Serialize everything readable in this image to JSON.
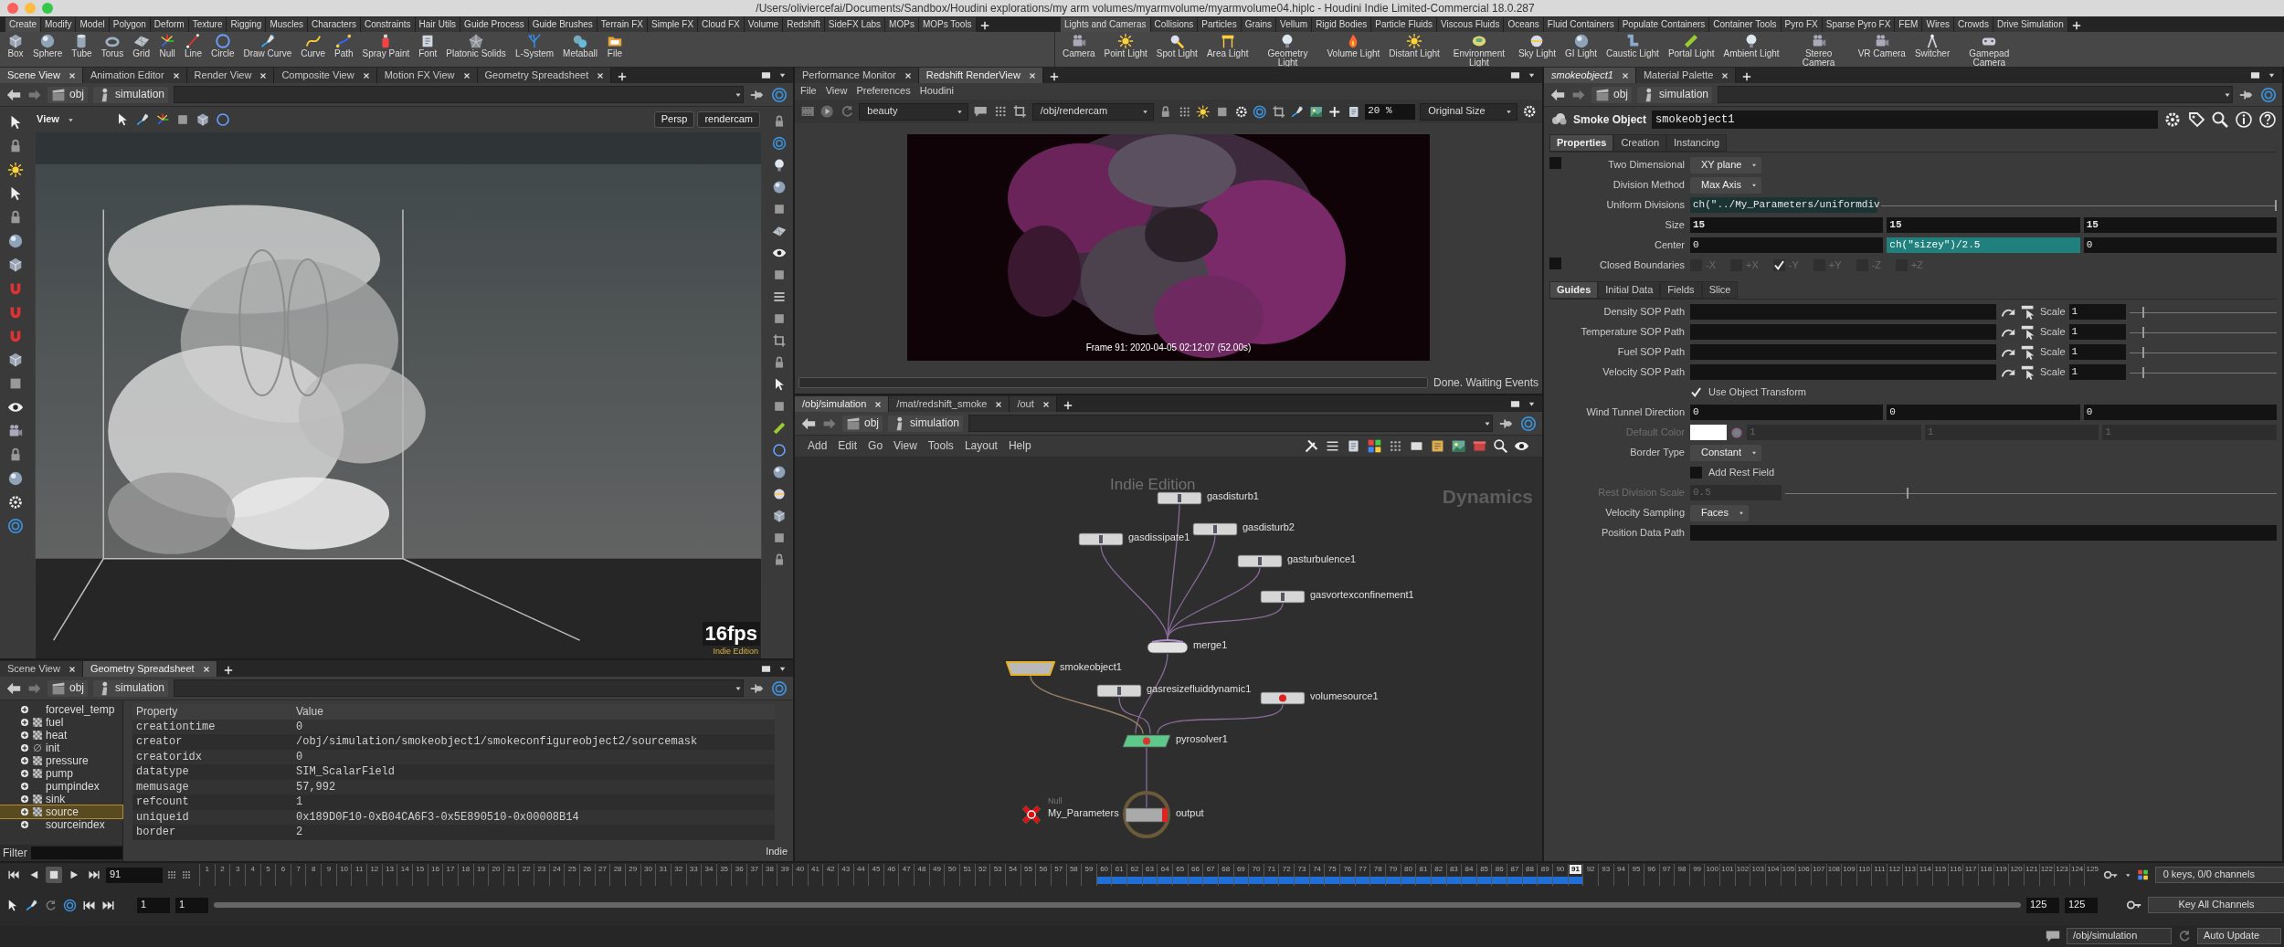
{
  "window": {
    "title": "/Users/oliviercefai/Documents/Sandbox/Houdini explorations/my arm volumes/myarmvolume/myarmvolume04.hiplc - Houdini Indie Limited-Commercial 18.0.287"
  },
  "shelves": [
    {
      "tabs": [
        {
          "label": "Create",
          "selected": true
        },
        {
          "label": "Modify",
          "selected": false
        },
        {
          "label": "Model",
          "selected": false
        },
        {
          "label": "Polygon",
          "selected": false
        },
        {
          "label": "Deform",
          "selected": false
        },
        {
          "label": "Texture",
          "selected": false
        },
        {
          "label": "Rigging",
          "selected": false
        },
        {
          "label": "Muscles",
          "selected": false
        },
        {
          "label": "Characters",
          "selected": false
        },
        {
          "label": "Constraints",
          "selected": false
        },
        {
          "label": "Hair Utils",
          "selected": false
        },
        {
          "label": "Guide Process",
          "selected": false
        },
        {
          "label": "Guide Brushes",
          "selected": false
        },
        {
          "label": "Terrain FX",
          "selected": false
        },
        {
          "label": "Simple FX",
          "selected": false
        },
        {
          "label": "Cloud FX",
          "selected": false
        },
        {
          "label": "Volume",
          "selected": false
        },
        {
          "label": "Redshift",
          "selected": false
        },
        {
          "label": "SideFX Labs",
          "selected": false
        },
        {
          "label": "MOPs",
          "selected": false
        },
        {
          "label": "MOPs Tools",
          "selected": false
        }
      ],
      "tools": [
        {
          "label": "Box"
        },
        {
          "label": "Sphere"
        },
        {
          "label": "Tube"
        },
        {
          "label": "Torus"
        },
        {
          "label": "Grid"
        },
        {
          "label": "Null"
        },
        {
          "label": "Line"
        },
        {
          "label": "Circle"
        },
        {
          "label": "Draw Curve"
        },
        {
          "label": "Curve"
        },
        {
          "label": "Path"
        },
        {
          "label": "Spray Paint"
        },
        {
          "label": "Font"
        },
        {
          "label": "Platonic Solids"
        },
        {
          "label": "L-System"
        },
        {
          "label": "Metaball"
        },
        {
          "label": "File"
        }
      ]
    },
    {
      "tabs": [
        {
          "label": "Lights and Cameras",
          "selected": true
        },
        {
          "label": "Collisions",
          "selected": false
        },
        {
          "label": "Particles",
          "selected": false
        },
        {
          "label": "Grains",
          "selected": false
        },
        {
          "label": "Vellum",
          "selected": false
        },
        {
          "label": "Rigid Bodies",
          "selected": false
        },
        {
          "label": "Particle Fluids",
          "selected": false
        },
        {
          "label": "Viscous Fluids",
          "selected": false
        },
        {
          "label": "Oceans",
          "selected": false
        },
        {
          "label": "Fluid Containers",
          "selected": false
        },
        {
          "label": "Populate Containers",
          "selected": false
        },
        {
          "label": "Container Tools",
          "selected": false
        },
        {
          "label": "Pyro FX",
          "selected": false
        },
        {
          "label": "Sparse Pyro FX",
          "selected": false
        },
        {
          "label": "FEM",
          "selected": false
        },
        {
          "label": "Wires",
          "selected": false
        },
        {
          "label": "Crowds",
          "selected": false
        },
        {
          "label": "Drive Simulation",
          "selected": false
        }
      ],
      "tools": [
        {
          "label": "Camera"
        },
        {
          "label": "Point Light"
        },
        {
          "label": "Spot Light"
        },
        {
          "label": "Area Light"
        },
        {
          "label": "Geometry Light"
        },
        {
          "label": "Volume Light"
        },
        {
          "label": "Distant Light"
        },
        {
          "label": "Environment Light"
        },
        {
          "label": "Sky Light"
        },
        {
          "label": "GI Light"
        },
        {
          "label": "Caustic Light"
        },
        {
          "label": "Portal Light"
        },
        {
          "label": "Ambient Light"
        },
        {
          "label": "Stereo Camera"
        },
        {
          "label": "VR Camera"
        },
        {
          "label": "Switcher"
        },
        {
          "label": "Gamepad Camera"
        }
      ]
    }
  ],
  "scene_view": {
    "tabs": [
      {
        "label": "Scene View",
        "selected": true
      },
      {
        "label": "Animation Editor",
        "selected": false
      },
      {
        "label": "Render View",
        "selected": false
      },
      {
        "label": "Composite View",
        "selected": false
      },
      {
        "label": "Motion FX View",
        "selected": false
      },
      {
        "label": "Geometry Spreadsheet",
        "selected": false
      }
    ],
    "path": [
      "obj",
      "simulation"
    ],
    "viewport": {
      "kind": "picture",
      "title": "View",
      "camera_buttons": [
        "Persp",
        "rendercam"
      ],
      "fps": "16fps",
      "watermark": "Indie Edition"
    }
  },
  "spreadsheet_pane": {
    "tabs": [
      {
        "label": "Scene View",
        "selected": false
      },
      {
        "label": "Geometry Spreadsheet",
        "selected": true
      }
    ],
    "path": [
      "obj",
      "simulation"
    ],
    "tree": [
      {
        "label": "forcevel_temp",
        "kind": "index",
        "selected": false
      },
      {
        "label": "fuel",
        "kind": "field",
        "selected": false
      },
      {
        "label": "heat",
        "kind": "field",
        "selected": false
      },
      {
        "label": "init",
        "kind": "empty",
        "selected": false
      },
      {
        "label": "pressure",
        "kind": "field",
        "selected": false
      },
      {
        "label": "pump",
        "kind": "field",
        "selected": false
      },
      {
        "label": "pumpindex",
        "kind": "index",
        "selected": false
      },
      {
        "label": "sink",
        "kind": "field",
        "selected": false
      },
      {
        "label": "source",
        "kind": "field",
        "selected": true
      },
      {
        "label": "sourceindex",
        "kind": "index",
        "selected": false
      }
    ],
    "filter_label": "Filter",
    "columns": [
      "Property",
      "Value"
    ],
    "rows": [
      {
        "property": "creationtime",
        "value": "0"
      },
      {
        "property": "creator",
        "value": "/obj/simulation/smokeobject1/smokeconfigureobject2/sourcemask"
      },
      {
        "property": "creatoridx",
        "value": "0"
      },
      {
        "property": "datatype",
        "value": "SIM_ScalarField"
      },
      {
        "property": "memusage",
        "value": "57,992"
      },
      {
        "property": "refcount",
        "value": "1"
      },
      {
        "property": "uniqueid",
        "value": "0x189D0F10-0xB04CA6F3-0x5E890510-0x00008B14"
      },
      {
        "property": "border",
        "value": "2"
      }
    ],
    "watermark": "Indie"
  },
  "render_view": {
    "tabs": [
      {
        "label": "Performance Monitor",
        "selected": false
      },
      {
        "label": "Redshift RenderView",
        "selected": true
      }
    ],
    "menu": [
      "File",
      "View",
      "Preferences",
      "Houdini"
    ],
    "aov": "beauty",
    "camera": "/obj/rendercam",
    "zoom": "20 %",
    "size_mode": "Original Size",
    "image": {
      "kind": "picture",
      "caption": "Frame 91: 2020-04-05 02:12:07 (52.00s)"
    },
    "progress": {
      "level": 0
    },
    "status": "Done. Waiting Events"
  },
  "network": {
    "tabs": [
      {
        "label": "/obj/simulation",
        "selected": true
      },
      {
        "label": "/mat/redshift_smoke",
        "selected": false
      },
      {
        "label": "/out",
        "selected": false
      }
    ],
    "path": [
      "obj",
      "simulation"
    ],
    "menu": [
      "Add",
      "Edit",
      "Go",
      "View",
      "Tools",
      "Layout",
      "Help"
    ],
    "watermark": "Indie Edition",
    "context": "Dynamics",
    "nodes": [
      {
        "name": "My_Parameters",
        "type_label": "Null",
        "kind": "null",
        "selected": false
      },
      {
        "name": "output",
        "kind": "output",
        "selected": false,
        "inputs": [
          {
            "name": "pyrosolver1",
            "kind": "solver",
            "selected": false,
            "inputs": [
              {
                "name": "merge1",
                "kind": "merge",
                "selected": false,
                "inputs": [
                  {
                    "name": "gasdisturb1",
                    "kind": "dop",
                    "selected": false
                  },
                  {
                    "name": "gasdisturb2",
                    "kind": "dop",
                    "selected": false
                  },
                  {
                    "name": "gasdissipate1",
                    "kind": "dop",
                    "selected": false
                  },
                  {
                    "name": "gasturbulence1",
                    "kind": "dop",
                    "selected": false
                  },
                  {
                    "name": "gasvortexconfinement1",
                    "kind": "dop",
                    "selected": false
                  }
                ]
              },
              {
                "name": "smokeobject1",
                "kind": "object",
                "selected": true
              },
              {
                "name": "gasresizefluiddynamic1",
                "kind": "dop",
                "selected": false
              },
              {
                "name": "volumesource1",
                "kind": "source",
                "selected": false
              }
            ]
          }
        ]
      }
    ]
  },
  "parameters": {
    "tabs": [
      {
        "label": "smokeobject1",
        "selected": true
      },
      {
        "label": "Material Palette",
        "selected": false
      }
    ],
    "path": [
      "obj",
      "simulation"
    ],
    "op_type": "Smoke Object",
    "op_name": "smokeobject1",
    "property_tabs": [
      {
        "label": "Properties",
        "selected": true
      },
      {
        "label": "Creation",
        "selected": false
      },
      {
        "label": "Instancing",
        "selected": false
      }
    ],
    "property_rows": [
      {
        "kind": "toggle-menu",
        "label": "Two Dimensional",
        "checked": false,
        "value": "XY plane",
        "disabled": false
      },
      {
        "kind": "menu",
        "label": "Division Method",
        "value": "Max Axis",
        "disabled": false
      },
      {
        "kind": "expression",
        "label": "Uniform Divisions",
        "value": "ch(\"../My_Parameters/uniformdiv",
        "level": 1,
        "disabled": false
      },
      {
        "kind": "vector",
        "label": "Size",
        "values": [
          {
            "text": "15",
            "changed": true,
            "expression": false
          },
          {
            "text": "15",
            "changed": true,
            "expression": false
          },
          {
            "text": "15",
            "changed": true,
            "expression": false
          }
        ],
        "disabled": false
      },
      {
        "kind": "vector",
        "label": "Center",
        "values": [
          {
            "text": "0",
            "changed": false,
            "expression": false
          },
          {
            "text": "ch(\"sizey\")/2.5",
            "changed": false,
            "expression": true
          },
          {
            "text": "0",
            "changed": false,
            "expression": false
          }
        ],
        "disabled": false
      },
      {
        "kind": "toggles",
        "label": "Closed Boundaries",
        "checked": false,
        "disabled": false,
        "options": [
          {
            "label": "-X",
            "checked": false
          },
          {
            "label": "+X",
            "checked": false
          },
          {
            "label": "-Y",
            "checked": true
          },
          {
            "label": "+Y",
            "checked": false
          },
          {
            "label": "-Z",
            "checked": false
          },
          {
            "label": "+Z",
            "checked": false
          }
        ]
      }
    ],
    "guide_tabs": [
      {
        "label": "Guides",
        "selected": true
      },
      {
        "label": "Initial Data",
        "selected": false
      },
      {
        "label": "Fields",
        "selected": false
      },
      {
        "label": "Slice",
        "selected": false
      }
    ],
    "guide_rows": [
      {
        "kind": "path",
        "label": "Density SOP Path",
        "scale_label": "Scale",
        "scale": "1",
        "level": 0.1,
        "disabled": false
      },
      {
        "kind": "path",
        "label": "Temperature SOP Path",
        "scale_label": "Scale",
        "scale": "1",
        "level": 0.1,
        "disabled": false
      },
      {
        "kind": "path",
        "label": "Fuel SOP Path",
        "scale_label": "Scale",
        "scale": "1",
        "level": 0.1,
        "disabled": false
      },
      {
        "kind": "path",
        "label": "Velocity SOP Path",
        "scale_label": "Scale",
        "scale": "1",
        "level": 0.1,
        "disabled": false
      },
      {
        "kind": "checkbox",
        "label": "Use Object Transform",
        "checked": true,
        "disabled": false
      },
      {
        "kind": "vector",
        "label": "Wind Tunnel Direction",
        "values": [
          {
            "text": "0",
            "changed": false,
            "expression": false
          },
          {
            "text": "0",
            "changed": false,
            "expression": false
          },
          {
            "text": "0",
            "changed": false,
            "expression": false
          }
        ],
        "disabled": false
      },
      {
        "kind": "color",
        "label": "Default Color",
        "color": "#ffffff",
        "values": [
          "1",
          "1",
          "1"
        ],
        "disabled": true
      },
      {
        "kind": "menu",
        "label": "Border Type",
        "value": "Constant",
        "disabled": false
      },
      {
        "kind": "checkbox",
        "label": "Add Rest Field",
        "checked": false,
        "disabled": false
      },
      {
        "kind": "float",
        "label": "Rest Division Scale",
        "value": "0.5",
        "level": 0.25,
        "disabled": true
      },
      {
        "kind": "menu",
        "label": "Velocity Sampling",
        "value": "Faces",
        "disabled": false
      },
      {
        "kind": "text",
        "label": "Position Data Path",
        "disabled": false
      }
    ]
  },
  "timeline": {
    "frame": "91",
    "start": "1",
    "range_start": "1",
    "range": {
      "level": 1
    },
    "range_end": "125",
    "end": "125",
    "keys_info": "0 keys, 0/0 channels",
    "key_button": "Key All Channels",
    "ticks": [
      {
        "label": "1",
        "cached": false,
        "selected": false
      },
      {
        "label": "2",
        "cached": false,
        "selected": false
      },
      {
        "label": "3",
        "cached": false,
        "selected": false
      },
      {
        "label": "4",
        "cached": false,
        "selected": false
      },
      {
        "label": "5",
        "cached": false,
        "selected": false
      },
      {
        "label": "6",
        "cached": false,
        "selected": false
      },
      {
        "label": "7",
        "cached": false,
        "selected": false
      },
      {
        "label": "8",
        "cached": false,
        "selected": false
      },
      {
        "label": "9",
        "cached": false,
        "selected": false
      },
      {
        "label": "10",
        "cached": false,
        "selected": false
      },
      {
        "label": "11",
        "cached": false,
        "selected": false
      },
      {
        "label": "12",
        "cached": false,
        "selected": false
      },
      {
        "label": "13",
        "cached": false,
        "selected": false
      },
      {
        "label": "14",
        "cached": false,
        "selected": false
      },
      {
        "label": "15",
        "cached": false,
        "selected": false
      },
      {
        "label": "16",
        "cached": false,
        "selected": false
      },
      {
        "label": "17",
        "cached": false,
        "selected": false
      },
      {
        "label": "18",
        "cached": false,
        "selected": false
      },
      {
        "label": "19",
        "cached": false,
        "selected": false
      },
      {
        "label": "20",
        "cached": false,
        "selected": false
      },
      {
        "label": "21",
        "cached": false,
        "selected": false
      },
      {
        "label": "22",
        "cached": false,
        "selected": false
      },
      {
        "label": "23",
        "cached": false,
        "selected": false
      },
      {
        "label": "24",
        "cached": false,
        "selected": false
      },
      {
        "label": "25",
        "cached": false,
        "selected": false
      },
      {
        "label": "26",
        "cached": false,
        "selected": false
      },
      {
        "label": "27",
        "cached": false,
        "selected": false
      },
      {
        "label": "28",
        "cached": false,
        "selected": false
      },
      {
        "label": "29",
        "cached": false,
        "selected": false
      },
      {
        "label": "30",
        "cached": false,
        "selected": false
      },
      {
        "label": "31",
        "cached": false,
        "selected": false
      },
      {
        "label": "32",
        "cached": false,
        "selected": false
      },
      {
        "label": "33",
        "cached": false,
        "selected": false
      },
      {
        "label": "34",
        "cached": false,
        "selected": false
      },
      {
        "label": "35",
        "cached": false,
        "selected": false
      },
      {
        "label": "36",
        "cached": false,
        "selected": false
      },
      {
        "label": "37",
        "cached": false,
        "selected": false
      },
      {
        "label": "38",
        "cached": false,
        "selected": false
      },
      {
        "label": "39",
        "cached": false,
        "selected": false
      },
      {
        "label": "40",
        "cached": false,
        "selected": false
      },
      {
        "label": "41",
        "cached": false,
        "selected": false
      },
      {
        "label": "42",
        "cached": false,
        "selected": false
      },
      {
        "label": "43",
        "cached": false,
        "selected": false
      },
      {
        "label": "44",
        "cached": false,
        "selected": false
      },
      {
        "label": "45",
        "cached": false,
        "selected": false
      },
      {
        "label": "46",
        "cached": false,
        "selected": false
      },
      {
        "label": "47",
        "cached": false,
        "selected": false
      },
      {
        "label": "48",
        "cached": false,
        "selected": false
      },
      {
        "label": "49",
        "cached": false,
        "selected": false
      },
      {
        "label": "50",
        "cached": false,
        "selected": false
      },
      {
        "label": "51",
        "cached": false,
        "selected": false
      },
      {
        "label": "52",
        "cached": false,
        "selected": false
      },
      {
        "label": "53",
        "cached": false,
        "selected": false
      },
      {
        "label": "54",
        "cached": false,
        "selected": false
      },
      {
        "label": "55",
        "cached": false,
        "selected": false
      },
      {
        "label": "56",
        "cached": false,
        "selected": false
      },
      {
        "label": "57",
        "cached": false,
        "selected": false
      },
      {
        "label": "58",
        "cached": false,
        "selected": false
      },
      {
        "label": "59",
        "cached": false,
        "selected": false
      },
      {
        "label": "60",
        "cached": true,
        "selected": false
      },
      {
        "label": "61",
        "cached": true,
        "selected": false
      },
      {
        "label": "62",
        "cached": true,
        "selected": false
      },
      {
        "label": "63",
        "cached": true,
        "selected": false
      },
      {
        "label": "64",
        "cached": true,
        "selected": false
      },
      {
        "label": "65",
        "cached": true,
        "selected": false
      },
      {
        "label": "66",
        "cached": true,
        "selected": false
      },
      {
        "label": "67",
        "cached": true,
        "selected": false
      },
      {
        "label": "68",
        "cached": true,
        "selected": false
      },
      {
        "label": "69",
        "cached": true,
        "selected": false
      },
      {
        "label": "70",
        "cached": true,
        "selected": false
      },
      {
        "label": "71",
        "cached": true,
        "selected": false
      },
      {
        "label": "72",
        "cached": true,
        "selected": false
      },
      {
        "label": "73",
        "cached": true,
        "selected": false
      },
      {
        "label": "74",
        "cached": true,
        "selected": false
      },
      {
        "label": "75",
        "cached": true,
        "selected": false
      },
      {
        "label": "76",
        "cached": true,
        "selected": false
      },
      {
        "label": "77",
        "cached": true,
        "selected": false
      },
      {
        "label": "78",
        "cached": true,
        "selected": false
      },
      {
        "label": "79",
        "cached": true,
        "selected": false
      },
      {
        "label": "80",
        "cached": true,
        "selected": false
      },
      {
        "label": "81",
        "cached": true,
        "selected": false
      },
      {
        "label": "82",
        "cached": true,
        "selected": false
      },
      {
        "label": "83",
        "cached": true,
        "selected": false
      },
      {
        "label": "84",
        "cached": true,
        "selected": false
      },
      {
        "label": "85",
        "cached": true,
        "selected": false
      },
      {
        "label": "86",
        "cached": true,
        "selected": false
      },
      {
        "label": "87",
        "cached": true,
        "selected": false
      },
      {
        "label": "88",
        "cached": true,
        "selected": false
      },
      {
        "label": "89",
        "cached": true,
        "selected": false
      },
      {
        "label": "90",
        "cached": true,
        "selected": false
      },
      {
        "label": "91",
        "cached": true,
        "selected": true
      },
      {
        "label": "92",
        "cached": false,
        "selected": false
      },
      {
        "label": "93",
        "cached": false,
        "selected": false
      },
      {
        "label": "94",
        "cached": false,
        "selected": false
      },
      {
        "label": "95",
        "cached": false,
        "selected": false
      },
      {
        "label": "96",
        "cached": false,
        "selected": false
      },
      {
        "label": "97",
        "cached": false,
        "selected": false
      },
      {
        "label": "98",
        "cached": false,
        "selected": false
      },
      {
        "label": "99",
        "cached": false,
        "selected": false
      },
      {
        "label": "100",
        "cached": false,
        "selected": false
      },
      {
        "label": "101",
        "cached": false,
        "selected": false
      },
      {
        "label": "102",
        "cached": false,
        "selected": false
      },
      {
        "label": "103",
        "cached": false,
        "selected": false
      },
      {
        "label": "104",
        "cached": false,
        "selected": false
      },
      {
        "label": "105",
        "cached": false,
        "selected": false
      },
      {
        "label": "106",
        "cached": false,
        "selected": false
      },
      {
        "label": "107",
        "cached": false,
        "selected": false
      },
      {
        "label": "108",
        "cached": false,
        "selected": false
      },
      {
        "label": "109",
        "cached": false,
        "selected": false
      },
      {
        "label": "110",
        "cached": false,
        "selected": false
      },
      {
        "label": "111",
        "cached": false,
        "selected": false
      },
      {
        "label": "112",
        "cached": false,
        "selected": false
      },
      {
        "label": "113",
        "cached": false,
        "selected": false
      },
      {
        "label": "114",
        "cached": false,
        "selected": false
      },
      {
        "label": "115",
        "cached": false,
        "selected": false
      },
      {
        "label": "116",
        "cached": false,
        "selected": false
      },
      {
        "label": "117",
        "cached": false,
        "selected": false
      },
      {
        "label": "118",
        "cached": false,
        "selected": false
      },
      {
        "label": "119",
        "cached": false,
        "selected": false
      },
      {
        "label": "120",
        "cached": false,
        "selected": false
      },
      {
        "label": "121",
        "cached": false,
        "selected": false
      },
      {
        "label": "122",
        "cached": false,
        "selected": false
      },
      {
        "label": "123",
        "cached": false,
        "selected": false
      },
      {
        "label": "124",
        "cached": false,
        "selected": false
      },
      {
        "label": "125",
        "cached": false,
        "selected": false
      }
    ]
  },
  "status_bar": {
    "path": "/obj/simulation",
    "update_mode": "Auto Update"
  }
}
